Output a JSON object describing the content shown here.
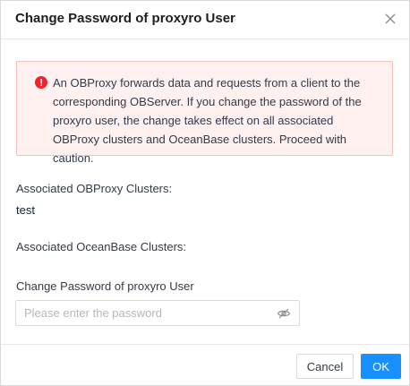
{
  "dialog": {
    "title": "Change Password of proxyro User",
    "close_icon": "close-icon"
  },
  "alert": {
    "icon": "error-circle-icon",
    "color": "#f5222d",
    "message": "An OBProxy forwards data and requests from a client to the corresponding OBServer. If you change the password of the proxyro user, the change takes effect on all associated OBProxy clusters and OceanBase clusters. Proceed with caution."
  },
  "associated_obproxy": {
    "label": "Associated OBProxy Clusters:",
    "value": "test"
  },
  "associated_oceanbase": {
    "label": "Associated OceanBase Clusters:",
    "value": ""
  },
  "password": {
    "label": "Change Password of proxyro User",
    "placeholder": "Please enter the password",
    "value": "",
    "toggle_icon": "eye-invisible-icon"
  },
  "footer": {
    "cancel_label": "Cancel",
    "ok_label": "OK",
    "primary_color": "#1890ff"
  }
}
